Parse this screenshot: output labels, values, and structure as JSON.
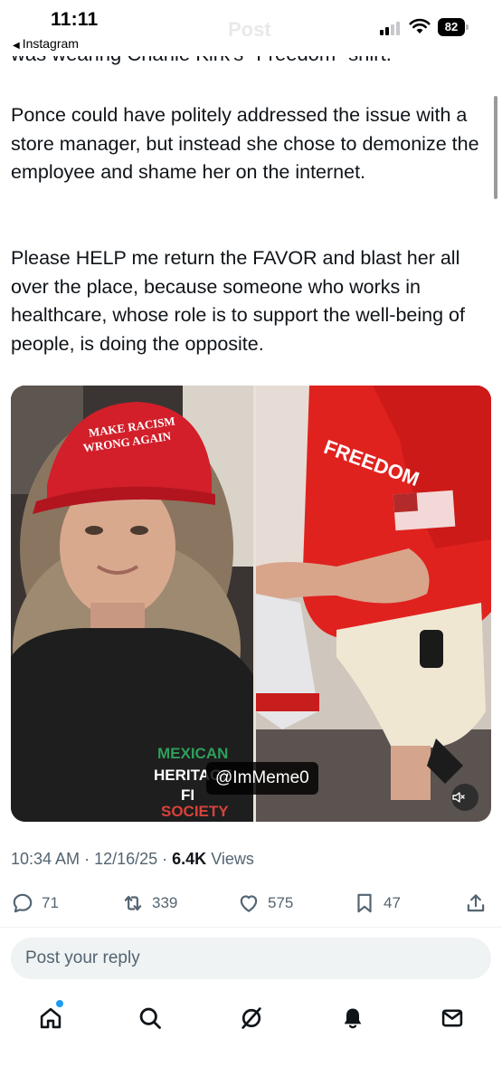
{
  "status_bar": {
    "time": "11:11",
    "back_app": "Instagram",
    "ghost_title": "Post",
    "battery": "82"
  },
  "tweet": {
    "clipped_line": "was wearing Charlie Kirk's \"Freedom\" shirt.",
    "paragraph_1": "Ponce could have politely addressed the issue with a store manager, but instead she chose to demonize the employee and shame her on the internet.",
    "paragraph_2": "Please HELP me return the FAVOR and blast her all over the place, because someone who works in healthcare, whose role is to support the well-being of people, is doing the opposite.",
    "media": {
      "watermark": "@ImMeme0",
      "hat_text_line1": "MAKE RACISM",
      "hat_text_line2": "WRONG AGAIN",
      "shirt_text_line1": "MEXICAN",
      "shirt_text_line2": "HERITAGE",
      "shirt_text_line3": "FI",
      "shirt_text_line4": "SOCIETY",
      "red_shirt_text": "FREEDOM"
    },
    "meta": {
      "time": "10:34 AM",
      "date": "12/16/25",
      "views_count": "6.4K",
      "views_label": "Views"
    },
    "actions": {
      "replies": "71",
      "reposts": "339",
      "likes": "575",
      "bookmarks": "47"
    }
  },
  "reply": {
    "placeholder": "Post your reply"
  },
  "colors": {
    "accent": "#1d9bf0",
    "muted_text": "#536471",
    "text": "#0f1419"
  },
  "nav_icons": [
    "home-icon",
    "search-icon",
    "grok-icon",
    "notifications-icon",
    "messages-icon"
  ]
}
